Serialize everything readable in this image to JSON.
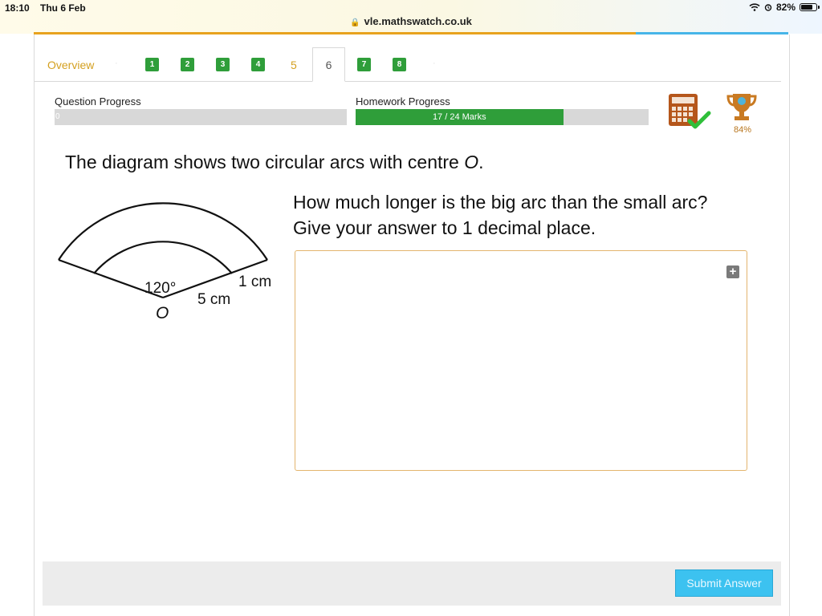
{
  "status_bar": {
    "time": "18:10",
    "date": "Thu 6 Feb",
    "battery_percent": "82%",
    "battery_level": 0.82
  },
  "browser": {
    "url": "vle.mathswatch.co.uk"
  },
  "tabs": {
    "overview": "Overview",
    "questions": [
      {
        "label": "1",
        "status": "complete"
      },
      {
        "label": "2",
        "status": "complete"
      },
      {
        "label": "3",
        "status": "complete"
      },
      {
        "label": "4",
        "status": "complete"
      },
      {
        "label": "5",
        "status": "attempted"
      },
      {
        "label": "6",
        "status": "active"
      },
      {
        "label": "7",
        "status": "complete"
      },
      {
        "label": "8",
        "status": "complete"
      }
    ]
  },
  "question_progress": {
    "label": "Question Progress",
    "value": "0",
    "fraction": 0
  },
  "homework_progress": {
    "label": "Homework Progress",
    "text": "17 / 24 Marks",
    "fraction": 0.7083
  },
  "score": {
    "percent": "84%"
  },
  "question": {
    "intro_prefix": "The diagram shows two circular arcs with centre ",
    "intro_var": "O",
    "intro_suffix": ".",
    "line1": "How much longer is the big arc than the small arc?",
    "line2": "Give your answer to 1 decimal place."
  },
  "diagram": {
    "angle_label": "120°",
    "inner_radius_label": "5 cm",
    "gap_label": "1 cm",
    "centre_label": "O"
  },
  "answer": {
    "value": ""
  },
  "footer": {
    "submit_label": "Submit Answer"
  },
  "colors": {
    "accent_orange": "#e8a21d",
    "complete_green": "#2f9e3a",
    "submit_blue": "#3cc2f0",
    "trophy_bronze": "#c97a22"
  }
}
